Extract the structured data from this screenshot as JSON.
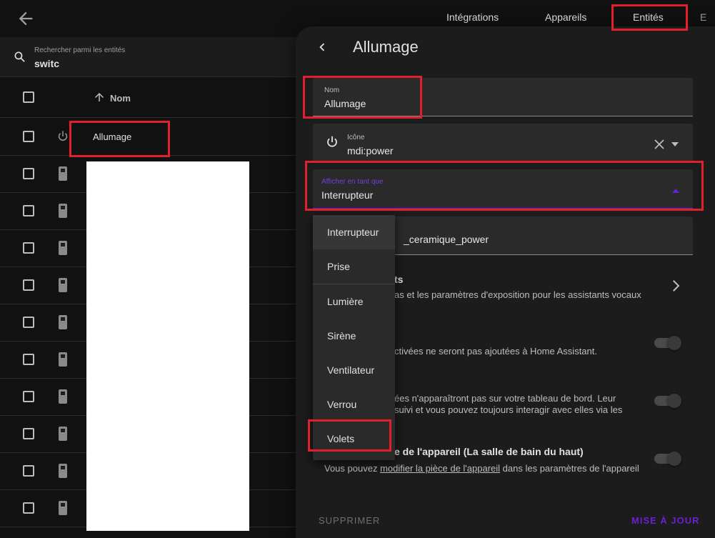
{
  "header": {
    "tabs": [
      {
        "label": "Intégrations"
      },
      {
        "label": "Appareils"
      },
      {
        "label": "Entités"
      },
      {
        "label": "E"
      }
    ]
  },
  "search": {
    "label": "Rechercher parmi les entités",
    "value": "switc"
  },
  "table": {
    "column_name": "Nom",
    "rows": [
      {
        "name": "Allumage",
        "icon": "power-icon"
      },
      {
        "name": "",
        "icon": "switch-icon"
      },
      {
        "name": "",
        "icon": "switch-icon"
      },
      {
        "name": "",
        "icon": "switch-icon"
      },
      {
        "name": "",
        "icon": "switch-icon"
      },
      {
        "name": "",
        "icon": "switch-icon"
      },
      {
        "name": "",
        "icon": "switch-icon"
      },
      {
        "name": "",
        "icon": "switch-icon"
      },
      {
        "name": "",
        "icon": "switch-icon"
      },
      {
        "name": "",
        "icon": "switch-icon"
      },
      {
        "name": "",
        "icon": "switch-icon"
      }
    ]
  },
  "dialog": {
    "title": "Allumage",
    "name_field": {
      "label": "Nom",
      "value": "Allumage"
    },
    "icon_field": {
      "label": "Icône",
      "value": "mdi:power"
    },
    "display_as_field": {
      "label": "Afficher en tant que",
      "value": "Interrupteur"
    },
    "entity_id_fragment": "_ceramique_power",
    "voice_title_fragment": "ts",
    "voice_desc_fragment": "as et les paramètres d'exposition pour les assistants vocaux",
    "enabled_desc_fragment": "ctivées ne seront pas ajoutées à Home Assistant.",
    "visible_desc_line1": "ées n'apparaîtront pas sur votre tableau de bord. Leur",
    "visible_desc_line2": "suivi et vous pouvez toujours interagir avec elles via les",
    "area_title_fragment": "e de l'appareil (La salle de bain du haut)",
    "area_desc_before": "Vous pouvez",
    "area_desc_link": "modifier la pièce de l'appareil",
    "area_desc_after": "dans les paramètres de l'appareil",
    "delete_label": "SUPPRIMER",
    "update_label": "MISE À JOUR"
  },
  "menu": {
    "items": [
      {
        "label": "Interrupteur",
        "selected": true
      },
      {
        "label": "Prise"
      },
      {
        "label": "Lumière"
      },
      {
        "label": "Sirène"
      },
      {
        "label": "Ventilateur"
      },
      {
        "label": "Verrou"
      },
      {
        "label": "Volets"
      }
    ]
  },
  "colors": {
    "accent": "#6a1fd1",
    "highlight_box": "#e0202a",
    "background": "#111111",
    "surface": "#1c1c1c"
  }
}
